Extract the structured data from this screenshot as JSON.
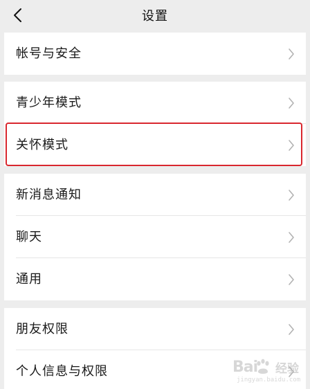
{
  "header": {
    "title": "设置"
  },
  "groups": [
    {
      "items": [
        {
          "label": "帐号与安全"
        }
      ]
    },
    {
      "items": [
        {
          "label": "青少年模式"
        },
        {
          "label": "关怀模式",
          "highlighted": true
        }
      ]
    },
    {
      "items": [
        {
          "label": "新消息通知"
        },
        {
          "label": "聊天"
        },
        {
          "label": "通用"
        }
      ]
    },
    {
      "items": [
        {
          "label": "朋友权限"
        },
        {
          "label": "个人信息与权限"
        }
      ]
    }
  ],
  "watermark": {
    "brand": "Bai",
    "brand_suffix": "经验",
    "url": "jingyan.baidu.com"
  },
  "icons": {
    "back": "back-arrow-icon",
    "row_chevron": "chevron-right-icon"
  },
  "colors": {
    "background": "#ededed",
    "row_background": "#ffffff",
    "highlight_border": "#d9272e",
    "chevron": "#b2b2b2"
  }
}
